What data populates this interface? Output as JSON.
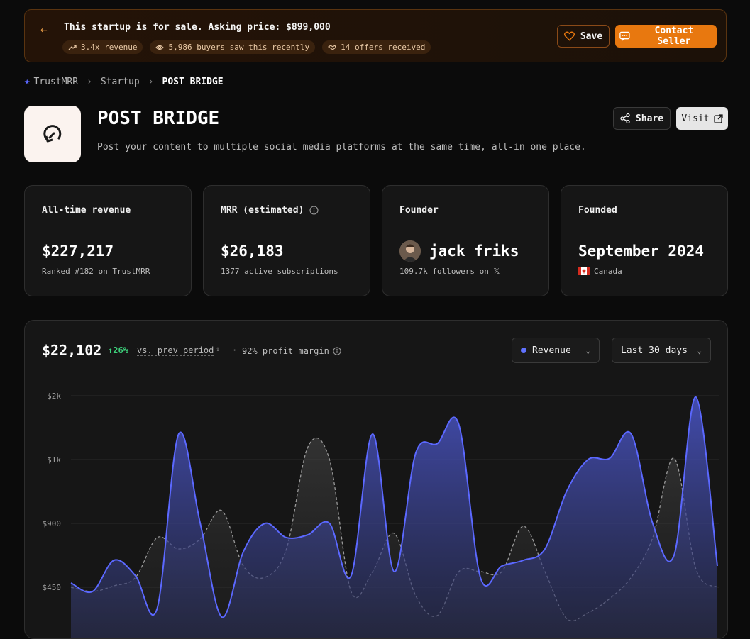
{
  "banner": {
    "sale_prefix": "This startup is for sale. Asking price: ",
    "price": "$899,000",
    "chips": [
      "3.4x revenue",
      "5,986 buyers saw this recently",
      "14 offers received"
    ],
    "save_label": "Save",
    "contact_label": "Contact Seller"
  },
  "breadcrumb": {
    "root": "TrustMRR",
    "section": "Startup",
    "current": "POST BRIDGE"
  },
  "startup": {
    "name": "POST BRIDGE",
    "tagline": "Post your content to multiple social media platforms at the same time, all-in one place.",
    "share_label": "Share",
    "visit_label": "Visit"
  },
  "cards": [
    {
      "label": "All-time revenue",
      "value": "$227,217",
      "sub": "Ranked #182 on TrustMRR"
    },
    {
      "label": "MRR (estimated)",
      "value": "$26,183",
      "sub": "1377 active subscriptions"
    },
    {
      "label": "Founder",
      "value": "jack friks",
      "sub": "109.7k followers on 𝕏"
    },
    {
      "label": "Founded",
      "value": "September 2024",
      "sub": "Canada"
    }
  ],
  "chart_panel": {
    "total": "$22,102",
    "growth": "↑26%",
    "prev_label": "vs. prev period",
    "separator": "·",
    "margin_label": "92% profit margin",
    "series_select": "Revenue",
    "range_select": "Last 30 days"
  },
  "colors": {
    "accent": "#e8780f",
    "series": "#5b68ff",
    "growth": "#3ccf7a"
  },
  "chart_data": {
    "type": "area",
    "y_tick_labels": [
      "$2k",
      "$1k",
      "$900",
      "$450"
    ],
    "series": [
      {
        "values": [
          480,
          420,
          640,
          530,
          300,
          1400,
          900,
          240,
          700,
          900,
          800,
          820,
          900,
          530,
          1400,
          560,
          1100,
          1250,
          1550,
          520,
          600,
          640,
          720,
          950,
          1000,
          1020,
          1400,
          900,
          680,
          1980,
          600
        ],
        "color": "#5b68ff",
        "style": "solid"
      },
      {
        "values": [
          450,
          420,
          460,
          520,
          800,
          720,
          790,
          920,
          600,
          520,
          720,
          1200,
          1000,
          420,
          560,
          830,
          390,
          250,
          560,
          560,
          560,
          880,
          560,
          230,
          270,
          370,
          520,
          800,
          1020,
          580,
          450
        ],
        "color": "#8a8a8a",
        "style": "dashed"
      }
    ]
  }
}
